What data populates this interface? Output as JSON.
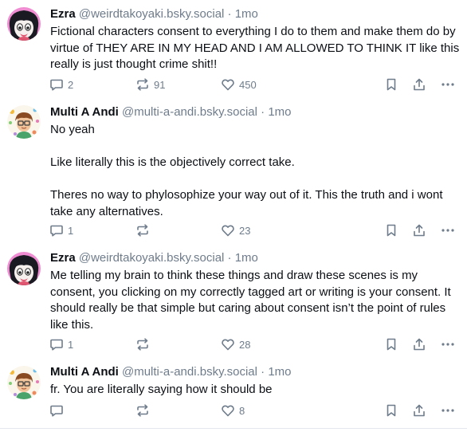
{
  "posts": [
    {
      "author": "Ezra",
      "handle": "@weirdtakoyaki.bsky.social",
      "separator": "·",
      "time": "1mo",
      "text": "Fictional characters consent to everything I do to them and make them do by virtue of THEY ARE IN MY HEAD AND I AM ALLOWED TO THINK IT like this really is just thought crime shit!!",
      "replies": "2",
      "reposts": "91",
      "likes": "450"
    },
    {
      "author": "Multi A Andi",
      "handle": "@multi-a-andi.bsky.social",
      "separator": "·",
      "time": "1mo",
      "text": "No yeah\n\nLike literally this is the objectively correct take.\n\nTheres no way to phylosophize your way out of it. This the truth and i wont take any alternatives.",
      "replies": "1",
      "reposts": "",
      "likes": "23"
    },
    {
      "author": "Ezra",
      "handle": "@weirdtakoyaki.bsky.social",
      "separator": "·",
      "time": "1mo",
      "text": "Me telling my brain to think these things and draw these scenes is my consent, you clicking on my correctly tagged art or writing is your consent. It should really be that simple but caring about consent isn’t the point of rules like this.",
      "replies": "1",
      "reposts": "",
      "likes": "28"
    },
    {
      "author": "Multi A Andi",
      "handle": "@multi-a-andi.bsky.social",
      "separator": "·",
      "time": "1mo",
      "text": "fr. You are literally saying how it should be",
      "replies": "",
      "reposts": "",
      "likes": "8"
    }
  ],
  "icons": {
    "reply": "reply-icon",
    "repost": "repost-icon",
    "like": "heart-icon",
    "bookmark": "bookmark-icon",
    "share": "share-icon",
    "more": "more-icon"
  },
  "colors": {
    "text": "#0b0f14",
    "muted": "#6f7c8b",
    "divider": "#e4e8ee"
  }
}
